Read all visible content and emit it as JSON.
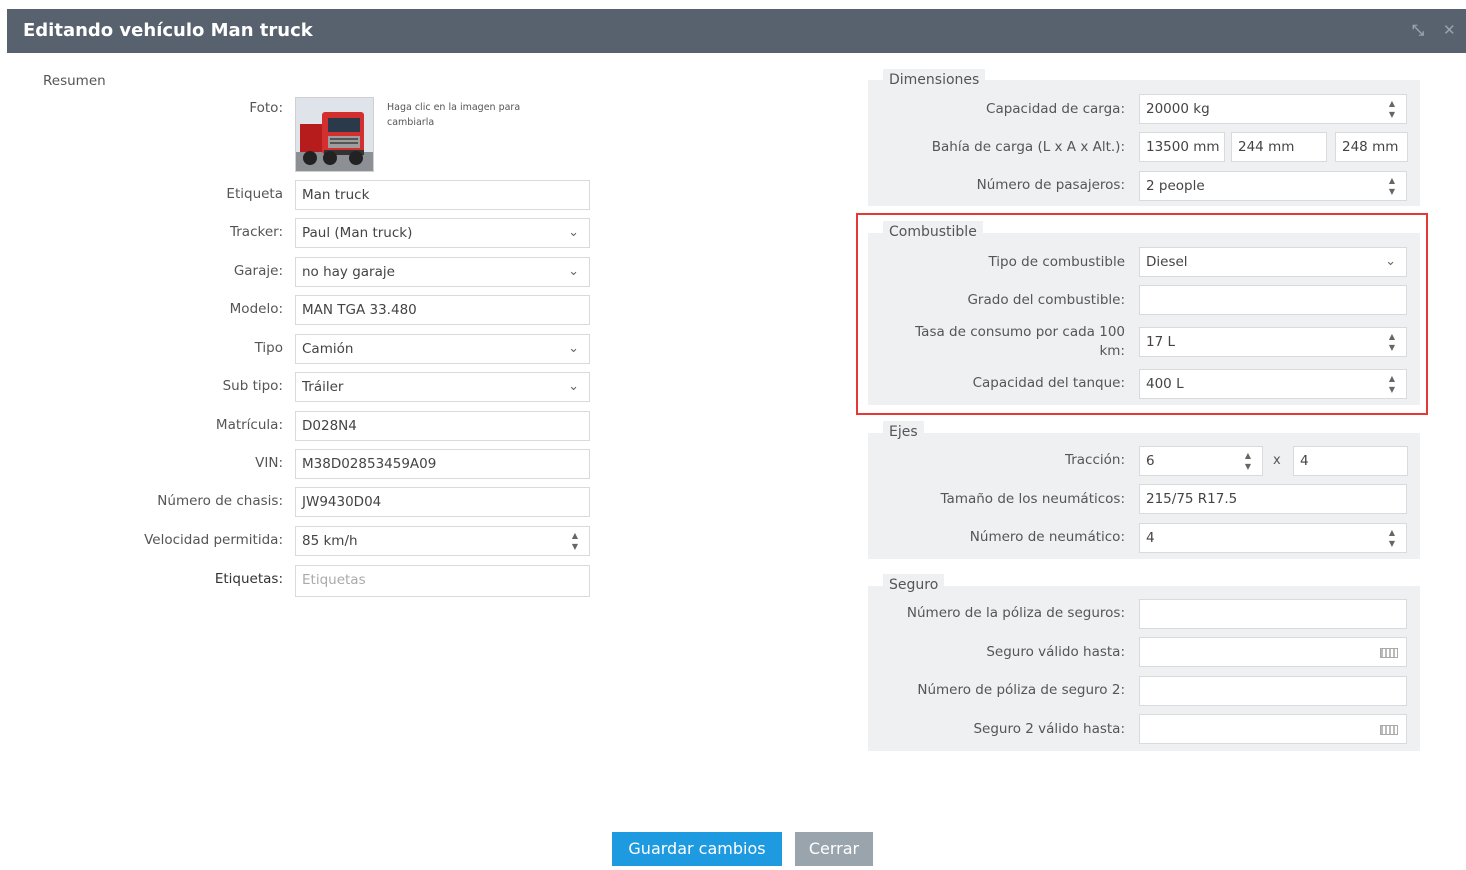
{
  "title": "Editando vehículo Man truck",
  "window": {
    "resize_icon": "resize-arrows-icon",
    "close_icon": "close-icon"
  },
  "summary": {
    "section_title": "Resumen",
    "photo_label": "Foto:",
    "photo_hint": "Haga clic en la imagen para cambiarla",
    "label_label": "Etiqueta",
    "label_value": "Man truck",
    "tracker_label": "Tracker:",
    "tracker_value": "Paul (Man truck)",
    "garage_label": "Garaje:",
    "garage_value": "no hay garaje",
    "model_label": "Modelo:",
    "model_value": "MAN TGA 33.480",
    "type_label": "Tipo",
    "type_value": "Camión",
    "subtype_label": "Sub tipo:",
    "subtype_value": "Tráiler",
    "plate_label": "Matrícula:",
    "plate_value": "D028N4",
    "vin_label": "VIN:",
    "vin_value": "M38D02853459A09",
    "chassis_label": "Número de chasis:",
    "chassis_value": "JW9430D04",
    "speed_label": "Velocidad permitida:",
    "speed_value": "85",
    "speed_unit": "km/h",
    "tags_label": "Etiquetas:",
    "tags_placeholder": "Etiquetas"
  },
  "dimensions": {
    "legend": "Dimensiones",
    "capacity_label": "Capacidad de carga:",
    "capacity_value": "20000",
    "capacity_unit": "kg",
    "bay_label": "Bahía de carga (L x A x Alt.):",
    "bay_length": "13500",
    "bay_length_unit": "mm",
    "bay_width": "244",
    "bay_width_unit": "mm",
    "bay_height": "248",
    "bay_height_unit": "mm",
    "passengers_label": "Número de pasajeros:",
    "passengers_value": "2",
    "passengers_unit": "people"
  },
  "fuel": {
    "legend": "Combustible",
    "type_label": "Tipo de combustible",
    "type_value": "Diesel",
    "grade_label": "Grado del combustible:",
    "grade_value": "",
    "consumption_label_1": "Tasa de consumo por cada 100",
    "consumption_label_2": "km:",
    "consumption_value": "17",
    "consumption_unit": "L",
    "tank_label": "Capacidad del tanque:",
    "tank_value": "400",
    "tank_unit": "L"
  },
  "axles": {
    "legend": "Ejes",
    "traction_label": "Tracción:",
    "traction_a": "6",
    "traction_sep": "x",
    "traction_b": "4",
    "tire_size_label": "Tamaño de los neumáticos:",
    "tire_size_value": "215/75 R17.5",
    "tire_count_label": "Número de neumático:",
    "tire_count_value": "4"
  },
  "insurance": {
    "legend": "Seguro",
    "policy_label": "Número de la póliza de seguros:",
    "valid_label": "Seguro válido hasta:",
    "policy2_label": "Número de póliza de seguro 2:",
    "valid2_label": "Seguro 2 válido hasta:"
  },
  "buttons": {
    "save": "Guardar cambios",
    "close": "Cerrar"
  },
  "colors": {
    "titlebar": "#58626e",
    "primary": "#1e9ae0",
    "secondary": "#9aa4ad",
    "highlight": "#e53935",
    "panel": "#eef0f2"
  }
}
